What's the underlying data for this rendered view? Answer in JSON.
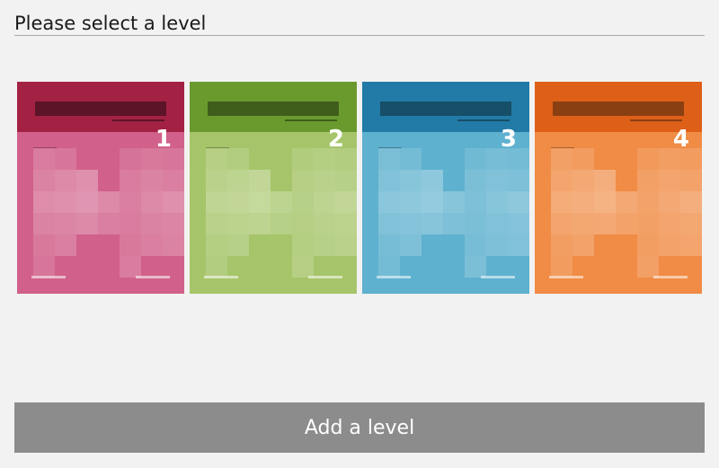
{
  "header": {
    "title": "Please select a level"
  },
  "levels": [
    {
      "label": "1",
      "colors": {
        "top": "#a32244",
        "body": "#d1608a",
        "bar": "#5c1428"
      }
    },
    {
      "label": "2",
      "colors": {
        "top": "#6a9a2e",
        "body": "#a6c56a",
        "bar": "#3f5e1c"
      }
    },
    {
      "label": "3",
      "colors": {
        "top": "#227aa6",
        "body": "#5eb1cf",
        "bar": "#174e68"
      }
    },
    {
      "label": "4",
      "colors": {
        "top": "#de5f18",
        "body": "#f08c45",
        "bar": "#8a3f12"
      }
    }
  ],
  "add_button": {
    "label": "Add a level"
  }
}
